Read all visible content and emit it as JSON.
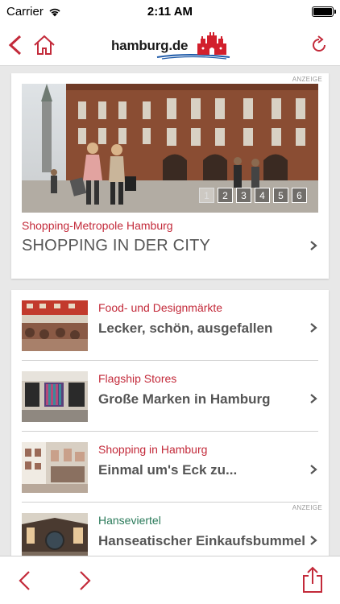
{
  "status": {
    "carrier": "Carrier",
    "time": "2:11 AM"
  },
  "header": {
    "logo_name": "hamburg",
    "logo_tld": ".de"
  },
  "featured": {
    "ad_label": "ANZEIGE",
    "pages": [
      "1",
      "2",
      "3",
      "4",
      "5",
      "6"
    ],
    "active_page": "1",
    "subtitle": "Shopping-Metropole Hamburg",
    "title": "SHOPPING IN DER CITY"
  },
  "list": [
    {
      "subtitle": "Food- und Designmärkte",
      "title": "Lecker, schön, ausgefallen"
    },
    {
      "subtitle": "Flagship Stores",
      "title": "Große Marken in Hamburg"
    },
    {
      "subtitle": "Shopping in Hamburg",
      "title": "Einmal um's Eck zu..."
    },
    {
      "subtitle": "Hanseviertel",
      "title": "Hanseatischer Einkaufsbummel",
      "ad_label": "ANZEIGE"
    }
  ],
  "colors": {
    "accent": "#c32a3a",
    "green": "#2a7a5a",
    "text": "#555555"
  }
}
